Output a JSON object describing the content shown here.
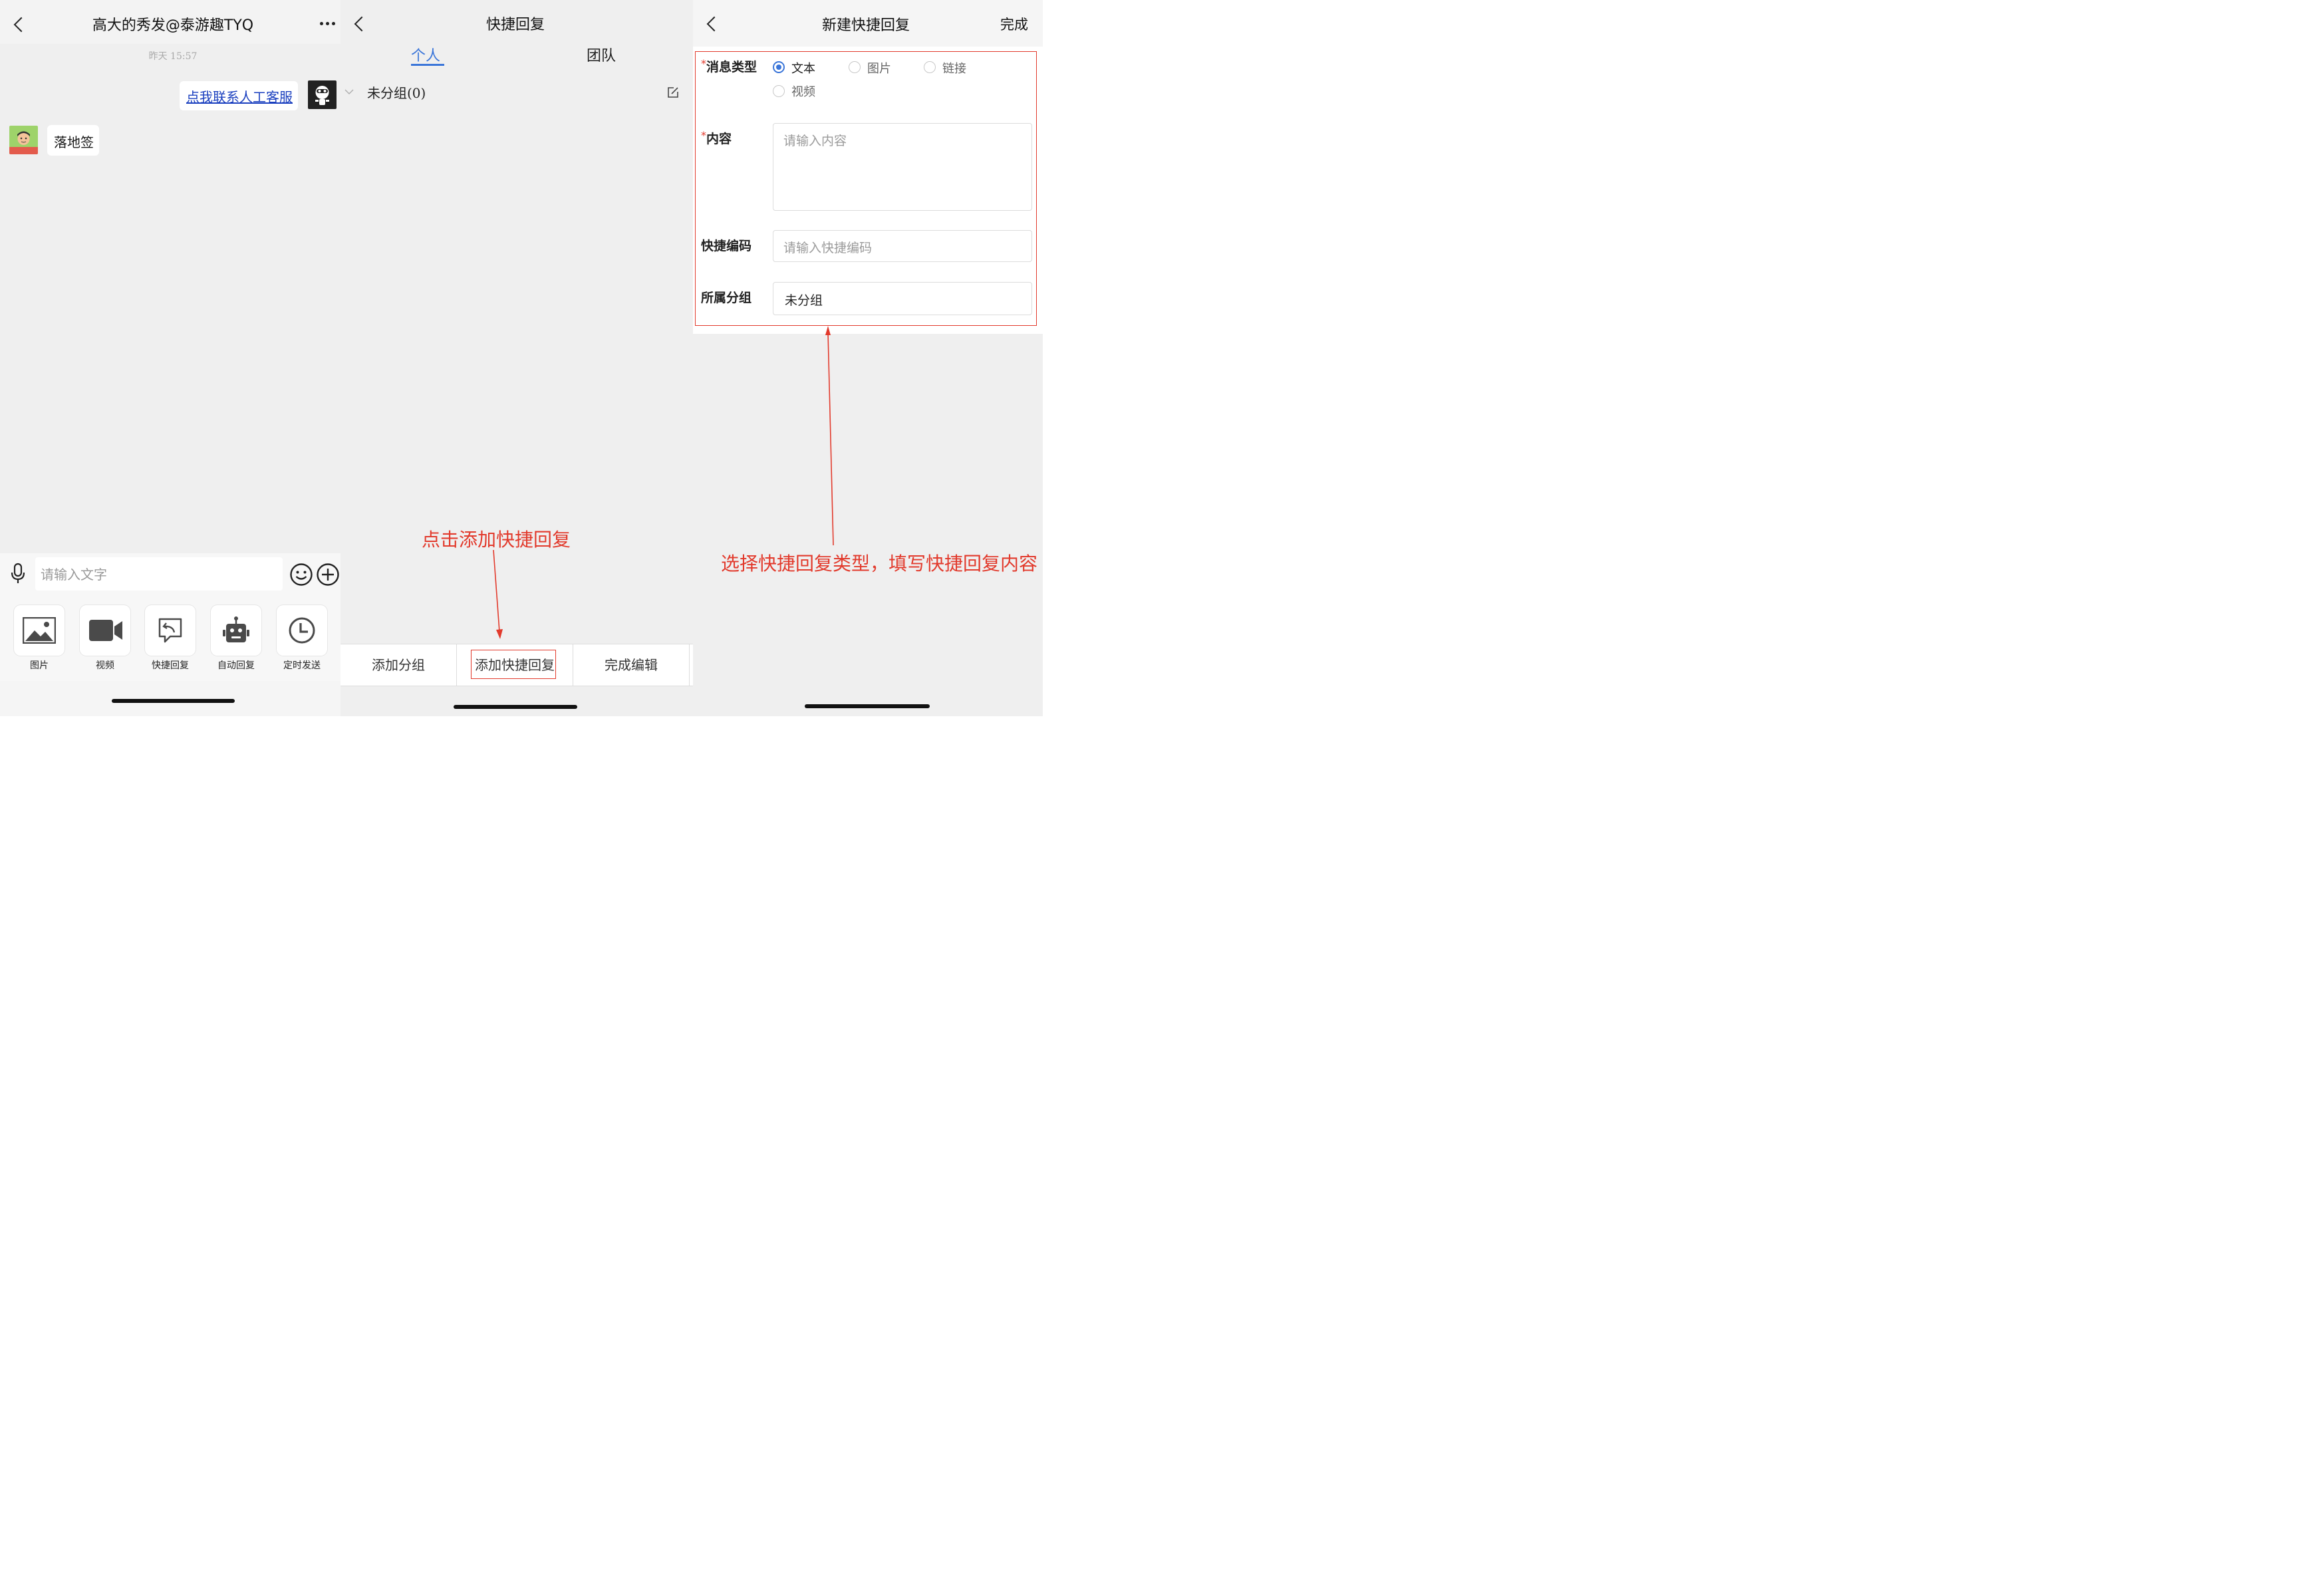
{
  "chat": {
    "title": "高大的秀发@泰游趣TYQ",
    "timestamp": "昨天 15:57",
    "outgoing_link": "点我联系人工客服",
    "incoming_text": "落地签",
    "input_placeholder": "请输入文字",
    "tools": [
      {
        "label": "图片",
        "icon": "image-icon"
      },
      {
        "label": "视频",
        "icon": "video-camera-icon"
      },
      {
        "label": "快捷回复",
        "icon": "quick-reply-icon"
      },
      {
        "label": "自动回复",
        "icon": "robot-icon"
      },
      {
        "label": "定时发送",
        "icon": "clock-icon"
      }
    ]
  },
  "quick_reply": {
    "title": "快捷回复",
    "tabs": [
      {
        "label": "个人",
        "active": true
      },
      {
        "label": "团队",
        "active": false
      }
    ],
    "group_label": "未分组(0)",
    "bottom_buttons": [
      "添加分组",
      "添加快捷回复",
      "完成编辑"
    ],
    "annotation": "点击添加快捷回复"
  },
  "new_reply": {
    "title": "新建快捷回复",
    "done_label": "完成",
    "required_mark": "*",
    "message_type_label": "消息类型",
    "message_types": [
      {
        "label": "文本",
        "selected": true
      },
      {
        "label": "图片",
        "selected": false
      },
      {
        "label": "链接",
        "selected": false
      },
      {
        "label": "视频",
        "selected": false
      }
    ],
    "content_label": "内容",
    "content_placeholder": "请输入内容",
    "code_label": "快捷编码",
    "code_placeholder": "请输入快捷编码",
    "group_label": "所属分组",
    "group_value": "未分组",
    "annotation": "选择快捷回复类型，填写快捷回复内容"
  },
  "colors": {
    "accent_blue": "#3b76d9",
    "annotation_red": "#e23a2c",
    "link_blue": "#1a3fbf",
    "panel_bg": "#efefef"
  }
}
